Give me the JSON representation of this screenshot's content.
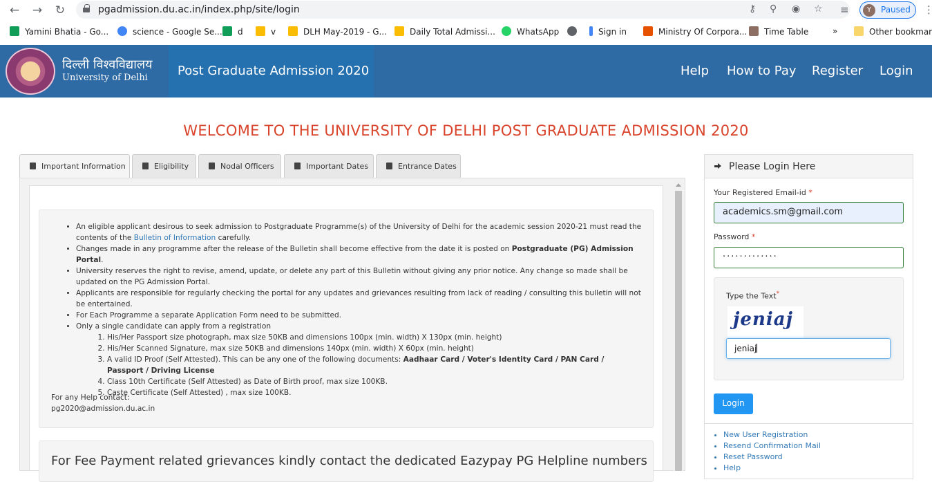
{
  "browser": {
    "url": "pgadmission.du.ac.in/index.php/site/login",
    "profile_initial": "Y",
    "profile_status": "Paused",
    "bookmarks": [
      {
        "label": "Yamini Bhatia - Go...",
        "color": "#0f9d58"
      },
      {
        "label": "science - Google Se...",
        "color": "#4285f4"
      },
      {
        "label": "d",
        "color": "#0f9d58"
      },
      {
        "label": "v",
        "color": "#fbbc04"
      },
      {
        "label": "DLH May-2019 - G...",
        "color": "#fbbc04"
      },
      {
        "label": "Daily Total Admissi...",
        "color": "#fbbc04"
      },
      {
        "label": "WhatsApp",
        "color": "#25d366"
      },
      {
        "label": "Sign in",
        "color": "#4285f4"
      },
      {
        "label": "Ministry Of Corpora...",
        "color": "#e65100"
      },
      {
        "label": "Time Table",
        "color": "#8d6e63"
      },
      {
        "label": "Other bookmarks",
        "color": "#f9d66b"
      }
    ],
    "bookmarks_more": "»"
  },
  "header": {
    "uni_hindi": "दिल्ली विश्वविद्यालय",
    "uni_english": "University of Delhi",
    "site_title": "Post Graduate Admission 2020",
    "nav": [
      "Help",
      "How to Pay",
      "Register",
      "Login"
    ]
  },
  "welcome": "WELCOME TO THE UNIVERSITY OF DELHI POST GRADUATE ADMISSION 2020",
  "tabs": [
    "Important Information",
    "Eligibility",
    "Nodal Officers",
    "Important Dates",
    "Entrance Dates"
  ],
  "info": {
    "p1_a": "An eligible applicant desirous to seek admission to Postgraduate Programme(s) of the University of Delhi for the academic session 2020-21 must read the contents of the ",
    "p1_link": "Bulletin of Information",
    "p1_b": " carefully.",
    "p2_a": "Changes made in any programme after the release of the Bulletin shall become effective from the date it is posted on ",
    "p2_bold": "Postgraduate (PG) Admission Portal",
    "p2_b": ".",
    "p3": "University reserves the right to revise, amend, update, or delete any part of this Bulletin without giving any prior notice. Any change so made shall be updated on the PG Admission Portal.",
    "p4": "Applicants are responsible for regularly checking the portal for any updates and grievances resulting from lack of reading / consulting this bulletin will not be entertained.",
    "p5": "For Each Programme a separate Application Form need to be submitted.",
    "p6": "Only a single candidate can apply from a registration",
    "sub1": "His/Her Passport size photograph, max size 50KB and dimensions 100px (min. width) X 130px (min. height)",
    "sub2": "His/Her Scanned Signature, max size 50KB and dimensions 140px (min. width) X 60px (min. height)",
    "sub3_a": "A valid ID Proof (Self Attested). This can be any one of the following documents: ",
    "sub3_bold": "Aadhaar Card / Voter's Identity Card / PAN Card / Passport / Driving License",
    "sub4": "Class 10th Certificate (Self Attested) as Date of Birth proof, max size 100KB.",
    "sub5": "Caste Certificate (Self Attested) , max size 100KB.",
    "help_label": "For any Help contact:",
    "help_email": "pg2020@admission.du.ac.in",
    "fee_text": "For Fee Payment related grievances kindly contact the dedicated Eazypay PG Helpline numbers"
  },
  "login": {
    "heading": "Please Login Here",
    "email_label": "Your Registered Email-id",
    "email_value": "academics.sm@gmail.com",
    "password_label": "Password",
    "password_value": "·············",
    "captcha_label": "Type the Text",
    "captcha_image_text": "jeniaj",
    "captcha_value": "jeniaj",
    "required_mark": "*",
    "login_button": "Login",
    "links": [
      "New User Registration",
      "Resend Confirmation Mail",
      "Reset Password",
      "Help"
    ]
  }
}
